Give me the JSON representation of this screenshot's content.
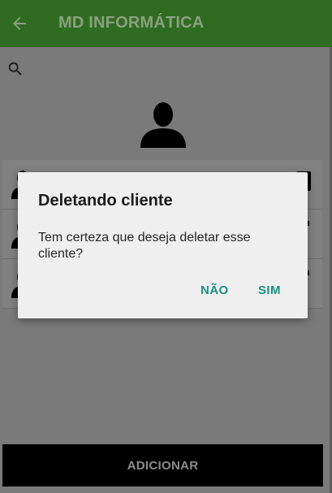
{
  "app_bar": {
    "title": "MD INFORMÁTICA",
    "back_icon": "arrow-back-icon"
  },
  "search": {
    "icon": "search-icon"
  },
  "list": {
    "rows": [
      {
        "avatar_icon": "person-icon",
        "action_icon": "contact-card-icon"
      },
      {
        "avatar_icon": "person-icon",
        "action_icon": "more-icon"
      },
      {
        "avatar_icon": "person-icon",
        "action_icon": "more-icon"
      }
    ]
  },
  "bottom_button": {
    "label": "ADICIONAR"
  },
  "dialog": {
    "title": "Deletando cliente",
    "message": "Tem certeza que deseja deletar esse cliente?",
    "negative_label": "NÃO",
    "positive_label": "SIM"
  },
  "colors": {
    "app_bar": "#2f6c21",
    "scrim": "#7a7a7a",
    "dialog_bg": "#efefef",
    "dialog_button": "#179080",
    "bottom_button": "#000000"
  }
}
